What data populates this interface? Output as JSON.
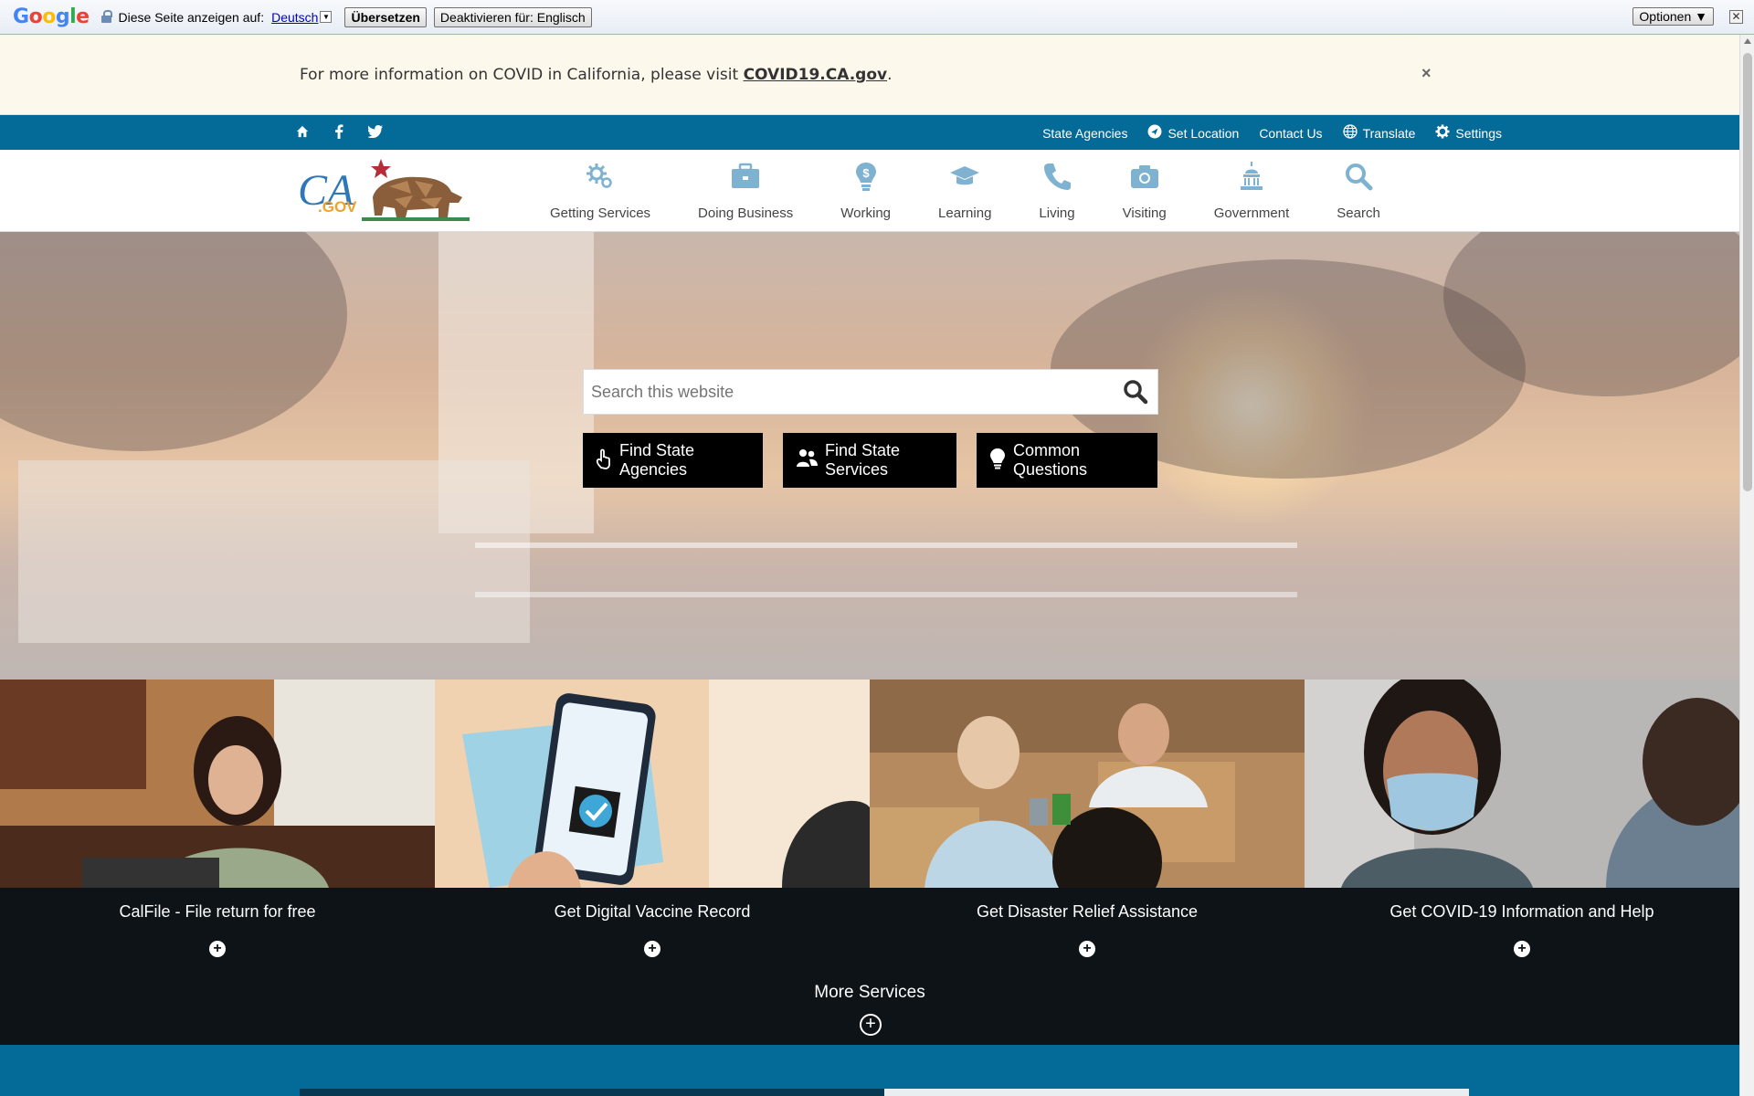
{
  "translate_bar": {
    "logo": "Google",
    "label": "Diese Seite anzeigen auf:",
    "language": "Deutsch",
    "caret": "▼",
    "translate_button": "Übersetzen",
    "disable_button": "Deaktivieren für: Englisch",
    "options_button": "Optionen ▼",
    "close": "✕"
  },
  "alert": {
    "text": "For more information on COVID in California, please visit ",
    "link": "COVID19.CA.gov",
    "suffix": ".",
    "close": "×"
  },
  "utility": {
    "left_icons": [
      "home-icon",
      "facebook-icon",
      "twitter-icon"
    ],
    "items": [
      "State Agencies",
      "Set Location",
      "Contact Us",
      "Translate",
      "Settings"
    ]
  },
  "nav": {
    "items": [
      "Getting Services",
      "Doing Business",
      "Working",
      "Learning",
      "Living",
      "Visiting",
      "Government",
      "Search"
    ]
  },
  "hero": {
    "search_placeholder": "Search this website",
    "buttons": [
      "Find State Agencies",
      "Find State Services",
      "Common Questions"
    ]
  },
  "services": {
    "cards": [
      "CalFile - File return for free",
      "Get Digital Vaccine Record",
      "Get Disaster Relief Assistance",
      "Get COVID-19 Information and Help"
    ],
    "plus": "+",
    "more": "More Services"
  },
  "colors": {
    "primary_blue": "#046b99",
    "alert_bg": "#fdf8ec",
    "nav_icon": "#7fb2d0",
    "dark": "#0d1317"
  }
}
